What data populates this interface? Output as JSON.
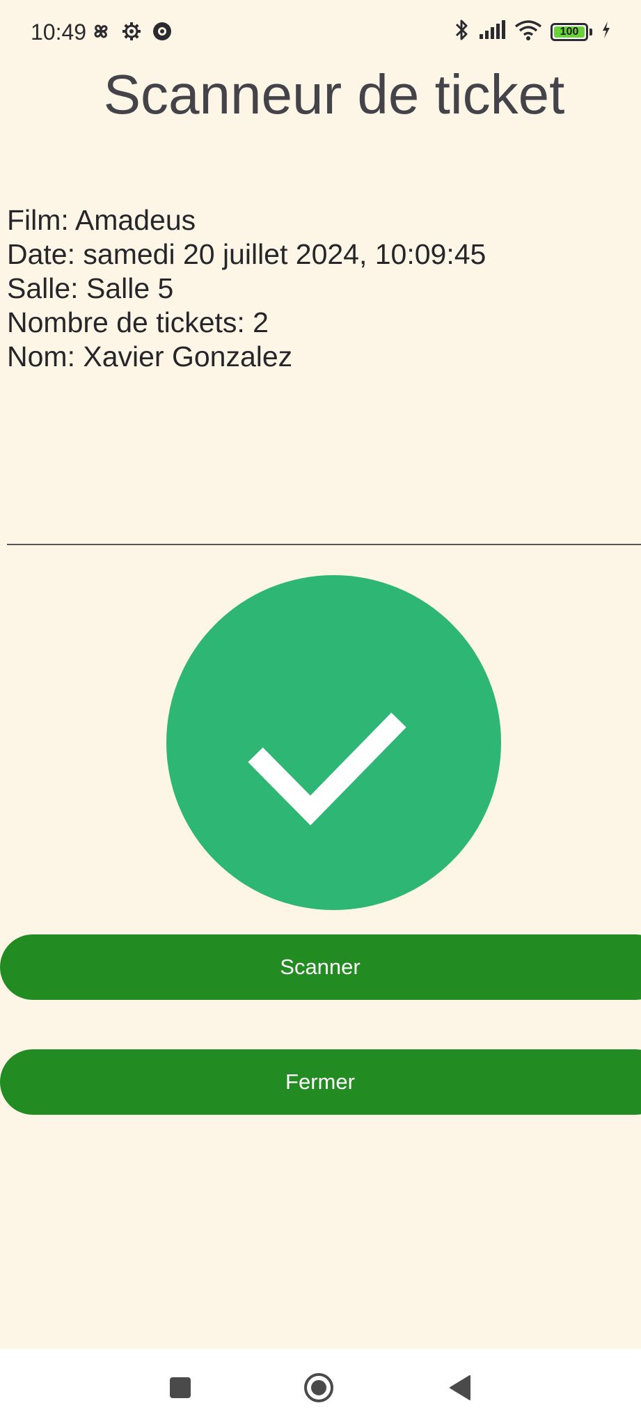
{
  "status_bar": {
    "time": "10:49",
    "battery_level": "100",
    "battery_fraction": 1.0,
    "battery_color": "#6ad13a",
    "left_icons": [
      "pinwheel-icon",
      "gear-icon",
      "record-icon"
    ],
    "right_icons": [
      "bluetooth-icon",
      "cellular-signal-icon",
      "wifi-icon",
      "battery-icon",
      "charging-icon"
    ]
  },
  "header": {
    "title": "Scanneur de ticket"
  },
  "ticket": {
    "film": "Film: Amadeus",
    "date": "Date: samedi 20 juillet 2024, 10:09:45",
    "room": "Salle: Salle 5",
    "ticket_count": "Nombre de tickets: 2",
    "name": "Nom: Xavier Gonzalez"
  },
  "status": {
    "icon": "check-circle-icon",
    "color": "#2eb674",
    "state": "valid"
  },
  "actions": {
    "scan_label": "Scanner",
    "close_label": "Fermer",
    "button_color": "#228b22"
  },
  "nav_bar": {
    "items": [
      "recents-square-icon",
      "home-circle-icon",
      "back-triangle-icon"
    ]
  }
}
